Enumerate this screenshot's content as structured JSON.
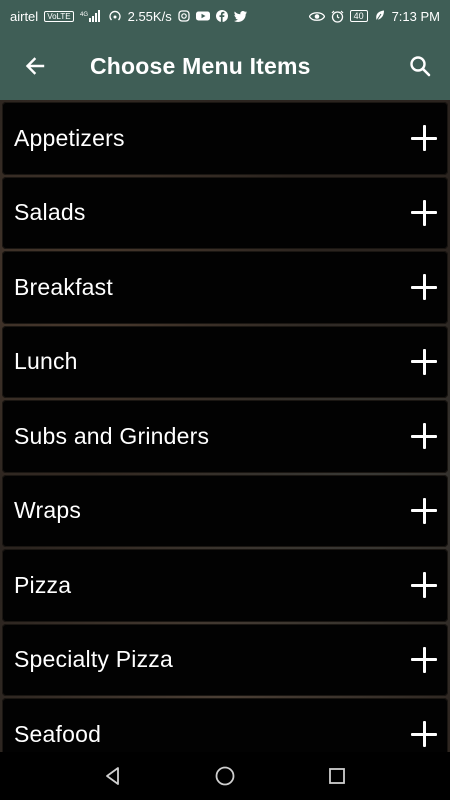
{
  "status_bar": {
    "carrier": "airtel",
    "volte": "VoLTE",
    "network": "4G",
    "speed": "2.55K/s",
    "battery": "40",
    "time": "7:13 PM"
  },
  "app_bar": {
    "title": "Choose Menu Items"
  },
  "menu": {
    "items": [
      {
        "label": "Appetizers"
      },
      {
        "label": "Salads"
      },
      {
        "label": "Breakfast"
      },
      {
        "label": "Lunch"
      },
      {
        "label": "Subs and Grinders"
      },
      {
        "label": "Wraps"
      },
      {
        "label": "Pizza"
      },
      {
        "label": "Specialty Pizza"
      },
      {
        "label": "Seafood"
      }
    ]
  },
  "colors": {
    "toolbar": "#3f5e56",
    "item_background": "#020202",
    "text": "#ffffff"
  },
  "icons": {
    "back": "arrow-left-icon",
    "search": "search-icon",
    "add": "plus-icon",
    "nav_back": "triangle-back-icon",
    "nav_home": "circle-home-icon",
    "nav_recents": "square-recents-icon"
  }
}
